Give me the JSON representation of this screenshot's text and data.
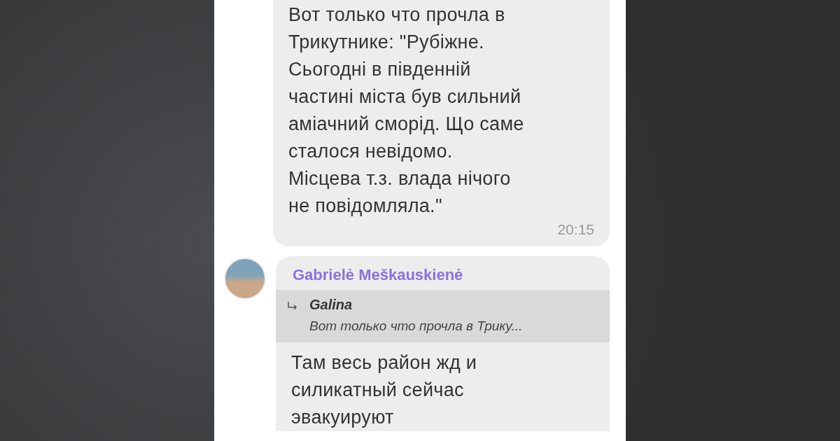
{
  "messages": [
    {
      "kind": "plain",
      "text": "Вот только что прочла в\nТрикутнике: \"Рубіжне.\nСьогодні в південній\nчастині міста був сильний\nаміачний сморід. Що саме\nсталося невідомо.\nМісцева т.з. влада нічого\nне повідомляла.\"",
      "time": "20:15"
    },
    {
      "kind": "reply",
      "sender": "Gabrielė Meškauskienė",
      "quote": {
        "author": "Galina",
        "text": "Вот только что прочла в Трику..."
      },
      "text": "Там весь район жд и\nсиликатный сейчас\nэвакуируют"
    }
  ]
}
